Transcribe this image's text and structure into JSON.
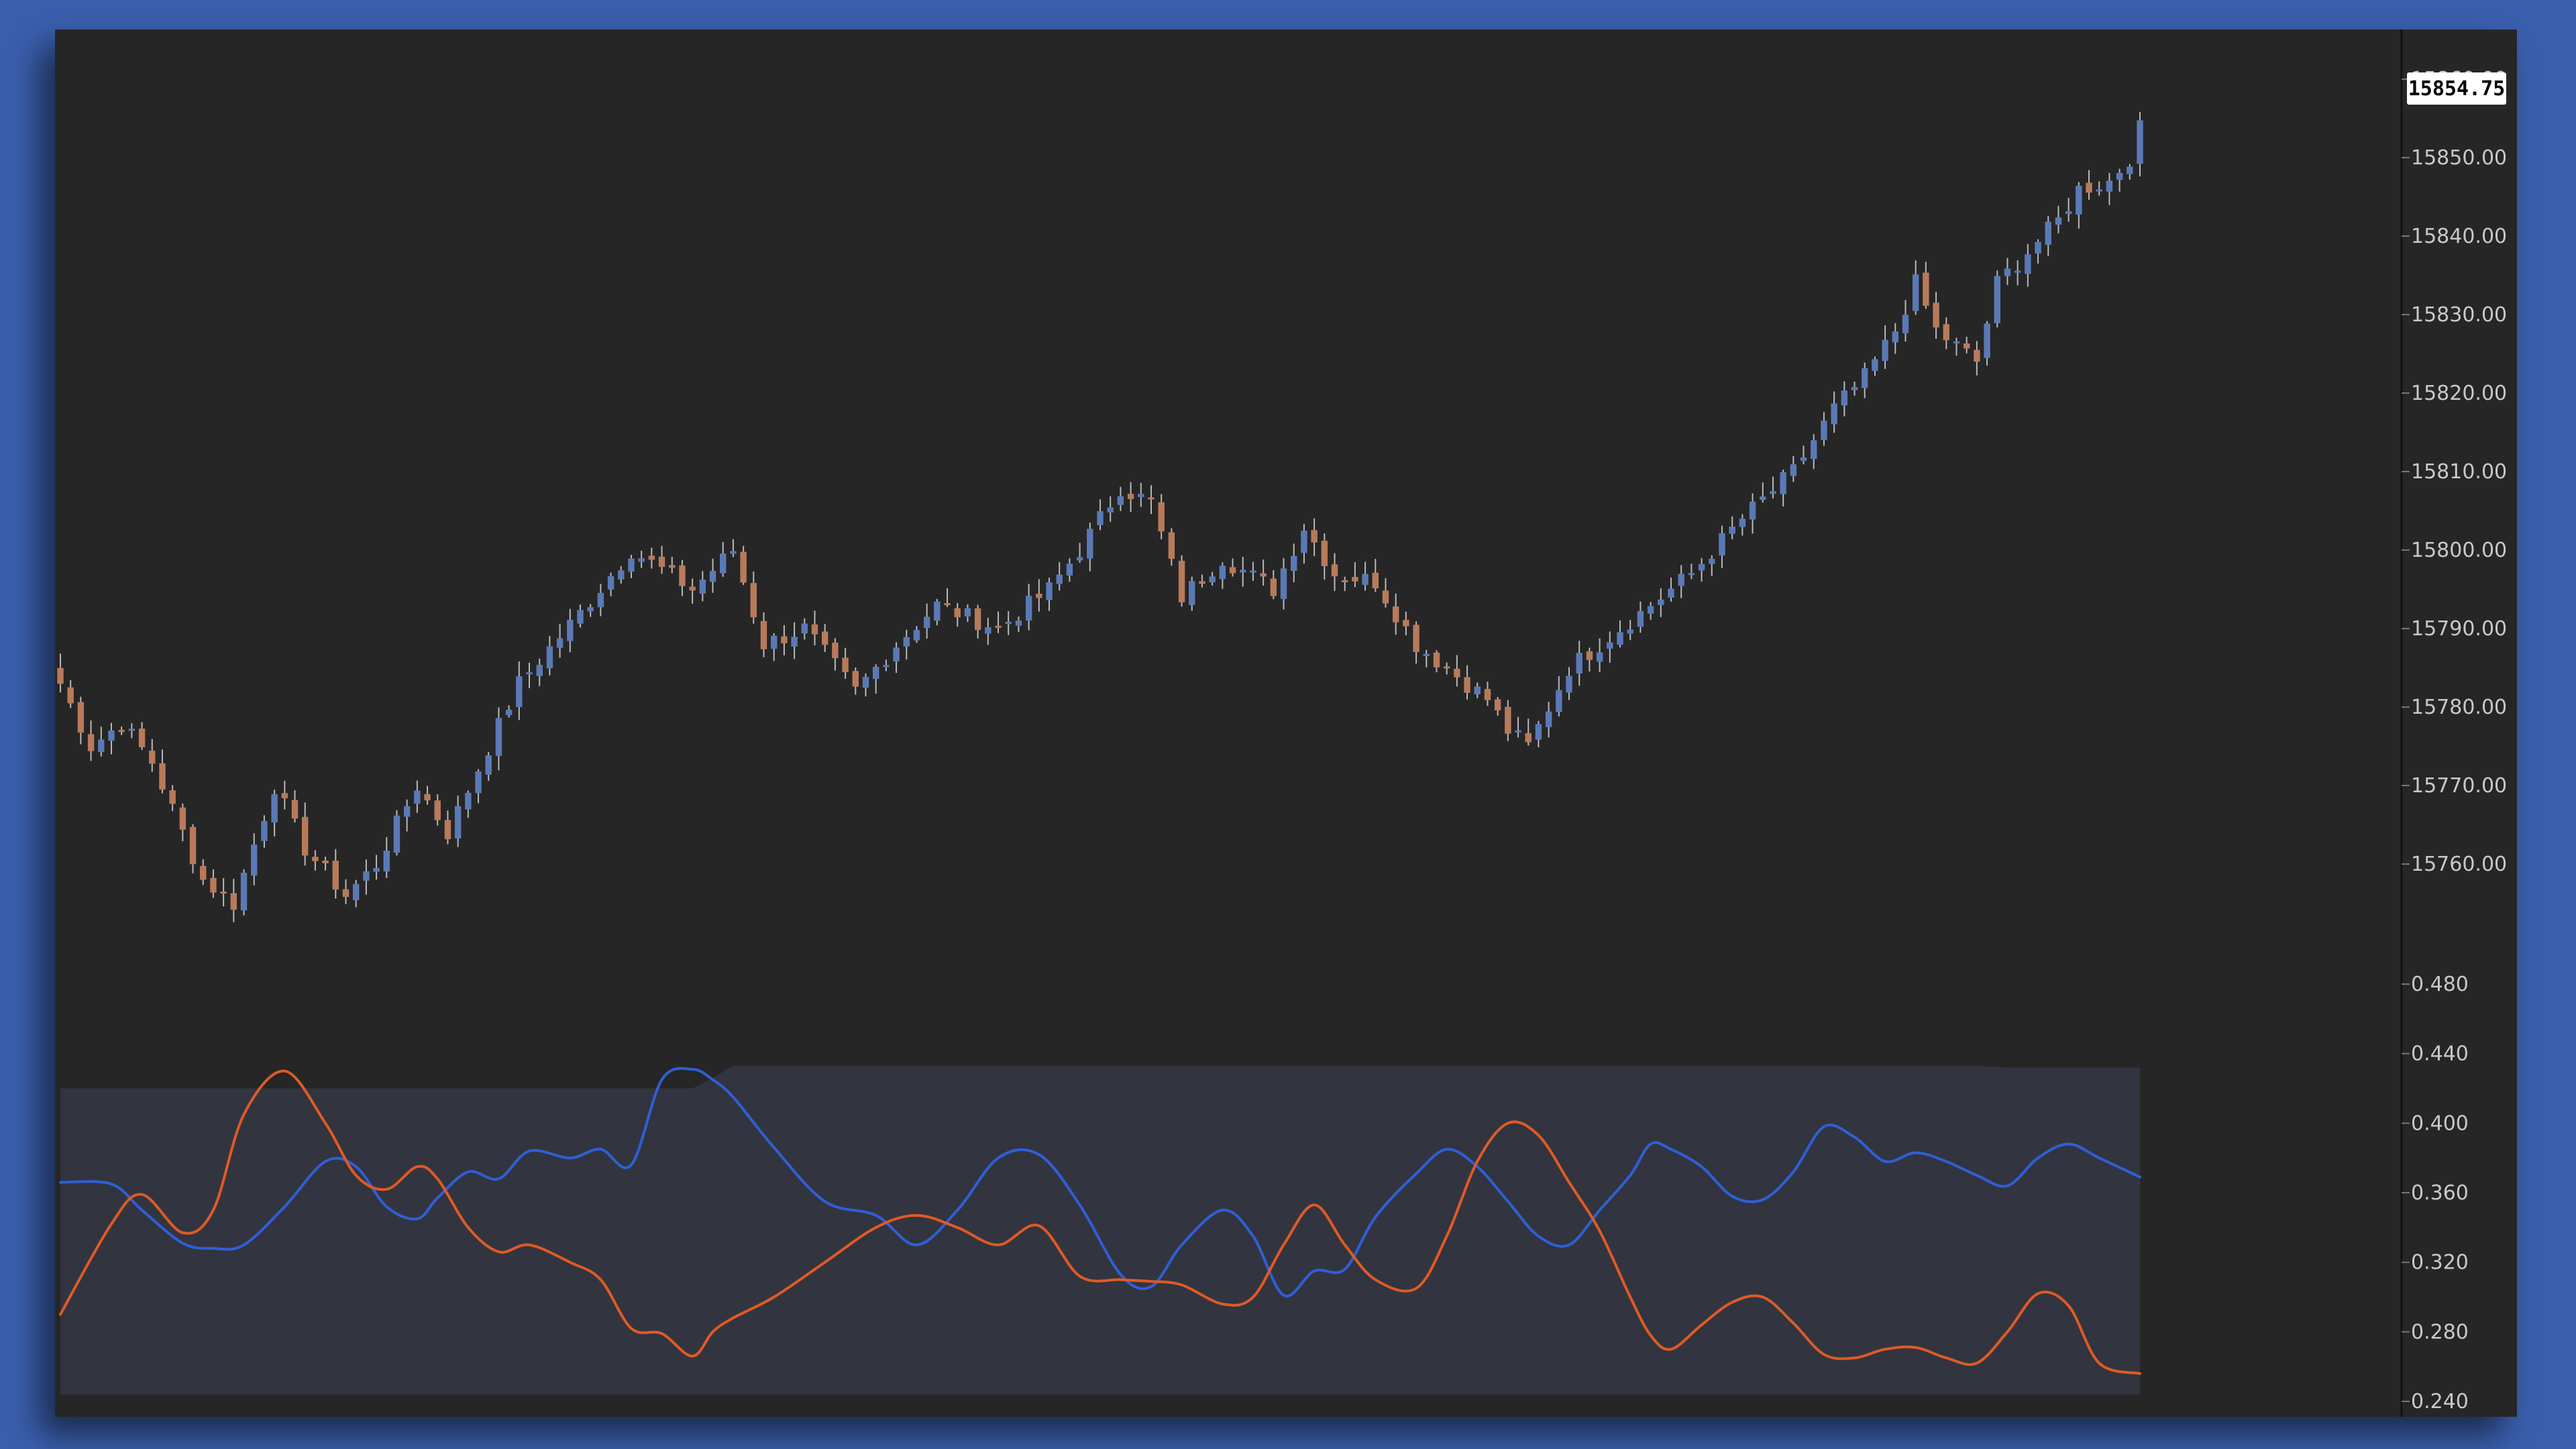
{
  "chart_data": [
    {
      "type": "candlestick",
      "title": "",
      "last_price": "15854.75",
      "y_ticks": [
        "15860.00",
        "15850.00",
        "15840.00",
        "15830.00",
        "15820.00",
        "15810.00",
        "15800.00",
        "15790.00",
        "15780.00",
        "15770.00",
        "15760.00"
      ],
      "ylim": [
        15760,
        15860
      ],
      "up_color": "#5a79b5",
      "down_color": "#b87a5a",
      "close_path": [
        [
          0,
          15783
        ],
        [
          3,
          15775
        ],
        [
          6,
          15778
        ],
        [
          9,
          15773
        ],
        [
          14,
          15758
        ],
        [
          17,
          15755
        ],
        [
          21,
          15770
        ],
        [
          24,
          15762
        ],
        [
          28,
          15756
        ],
        [
          31,
          15760
        ],
        [
          35,
          15770
        ],
        [
          38,
          15764
        ],
        [
          45,
          15783
        ],
        [
          51,
          15792
        ],
        [
          56,
          15800
        ],
        [
          62,
          15795
        ],
        [
          66,
          15800
        ],
        [
          69,
          15788
        ],
        [
          73,
          15790
        ],
        [
          78,
          15782
        ],
        [
          82,
          15788
        ],
        [
          86,
          15793
        ],
        [
          92,
          15790
        ],
        [
          97,
          15795
        ],
        [
          100,
          15800
        ],
        [
          104,
          15808
        ],
        [
          107,
          15806
        ],
        [
          110,
          15794
        ],
        [
          114,
          15799
        ],
        [
          119,
          15795
        ],
        [
          122,
          15803
        ],
        [
          125,
          15797
        ],
        [
          129,
          15796
        ],
        [
          133,
          15788
        ],
        [
          136,
          15785
        ],
        [
          140,
          15781
        ],
        [
          142,
          15777
        ],
        [
          144,
          15775
        ],
        [
          148,
          15785
        ],
        [
          152,
          15789
        ],
        [
          156,
          15793
        ],
        [
          160,
          15797
        ],
        [
          165,
          15804
        ],
        [
          170,
          15810
        ],
        [
          172,
          15814
        ],
        [
          174,
          15818
        ],
        [
          177,
          15822
        ],
        [
          180,
          15828
        ],
        [
          182,
          15834
        ],
        [
          184,
          15828
        ],
        [
          186,
          15826
        ],
        [
          188,
          15824
        ],
        [
          190,
          15834
        ],
        [
          193,
          15838
        ],
        [
          196,
          15842
        ],
        [
          198,
          15846
        ],
        [
          201,
          15847
        ],
        [
          203,
          15850
        ],
        [
          204,
          15854.75
        ]
      ],
      "candle_count": 205
    },
    {
      "type": "line",
      "title": "",
      "y_ticks": [
        "0.480",
        "0.440",
        "0.400",
        "0.360",
        "0.320",
        "0.280",
        "0.240"
      ],
      "ylim": [
        0.235,
        0.485
      ],
      "x": [
        0,
        5,
        8,
        12,
        15,
        18,
        22,
        26,
        29,
        32,
        35,
        37,
        40,
        43,
        46,
        50,
        53,
        56,
        59,
        62,
        64,
        66,
        70,
        75,
        80,
        84,
        88,
        92,
        96,
        100,
        104,
        107,
        110,
        114,
        117,
        120,
        123,
        126,
        129,
        133,
        136,
        139,
        142,
        145,
        148,
        151,
        154,
        156,
        158,
        161,
        164,
        167,
        170,
        173,
        176,
        179,
        182,
        185,
        188,
        191,
        194,
        197,
        200,
        204
      ],
      "band": {
        "upper": [
          0.42,
          0.42,
          0.42,
          0.42,
          0.42,
          0.42,
          0.42,
          0.42,
          0.42,
          0.42,
          0.42,
          0.42,
          0.42,
          0.42,
          0.42,
          0.42,
          0.42,
          0.42,
          0.42,
          0.42,
          0.426,
          0.433,
          0.433,
          0.433,
          0.433,
          0.433,
          0.433,
          0.433,
          0.433,
          0.433,
          0.433,
          0.433,
          0.433,
          0.433,
          0.433,
          0.433,
          0.433,
          0.433,
          0.433,
          0.433,
          0.433,
          0.433,
          0.433,
          0.433,
          0.433,
          0.433,
          0.433,
          0.433,
          0.433,
          0.433,
          0.433,
          0.433,
          0.433,
          0.433,
          0.433,
          0.433,
          0.433,
          0.433,
          0.433,
          0.432,
          0.432,
          0.432,
          0.432,
          0.432
        ],
        "lower": [
          0.244,
          0.244,
          0.244,
          0.244,
          0.244,
          0.244,
          0.244,
          0.244,
          0.244,
          0.244,
          0.244,
          0.244,
          0.244,
          0.244,
          0.244,
          0.244,
          0.244,
          0.244,
          0.244,
          0.244,
          0.244,
          0.244,
          0.244,
          0.244,
          0.244,
          0.244,
          0.244,
          0.244,
          0.244,
          0.244,
          0.244,
          0.244,
          0.244,
          0.244,
          0.244,
          0.244,
          0.244,
          0.244,
          0.244,
          0.244,
          0.244,
          0.244,
          0.244,
          0.244,
          0.244,
          0.244,
          0.244,
          0.244,
          0.244,
          0.244,
          0.244,
          0.244,
          0.244,
          0.244,
          0.244,
          0.244,
          0.244,
          0.244,
          0.244,
          0.244,
          0.244,
          0.244,
          0.244,
          0.244
        ],
        "color": "#333640"
      },
      "series": [
        {
          "color": "#2f5fd8",
          "values": [
            0.366,
            0.365,
            0.35,
            0.331,
            0.328,
            0.33,
            0.352,
            0.378,
            0.375,
            0.352,
            0.345,
            0.357,
            0.372,
            0.368,
            0.384,
            0.38,
            0.385,
            0.376,
            0.425,
            0.431,
            0.425,
            0.415,
            0.386,
            0.355,
            0.347,
            0.33,
            0.35,
            0.38,
            0.382,
            0.353,
            0.313,
            0.306,
            0.33,
            0.35,
            0.335,
            0.301,
            0.315,
            0.316,
            0.346,
            0.371,
            0.385,
            0.375,
            0.355,
            0.335,
            0.33,
            0.35,
            0.37,
            0.388,
            0.385,
            0.375,
            0.358,
            0.356,
            0.372,
            0.398,
            0.392,
            0.378,
            0.383,
            0.378,
            0.37,
            0.364,
            0.38,
            0.388,
            0.38,
            0.369
          ]
        },
        {
          "color": "#e05a25",
          "values": [
            0.29,
            0.342,
            0.359,
            0.337,
            0.35,
            0.405,
            0.43,
            0.4,
            0.37,
            0.362,
            0.375,
            0.368,
            0.34,
            0.326,
            0.33,
            0.32,
            0.31,
            0.282,
            0.279,
            0.266,
            0.28,
            0.288,
            0.3,
            0.32,
            0.34,
            0.347,
            0.34,
            0.33,
            0.341,
            0.312,
            0.31,
            0.309,
            0.307,
            0.296,
            0.3,
            0.33,
            0.353,
            0.33,
            0.31,
            0.305,
            0.335,
            0.378,
            0.4,
            0.393,
            0.366,
            0.338,
            0.3,
            0.278,
            0.27,
            0.284,
            0.297,
            0.3,
            0.285,
            0.267,
            0.265,
            0.27,
            0.271,
            0.265,
            0.262,
            0.28,
            0.302,
            0.295,
            0.262,
            0.256
          ]
        }
      ]
    }
  ]
}
